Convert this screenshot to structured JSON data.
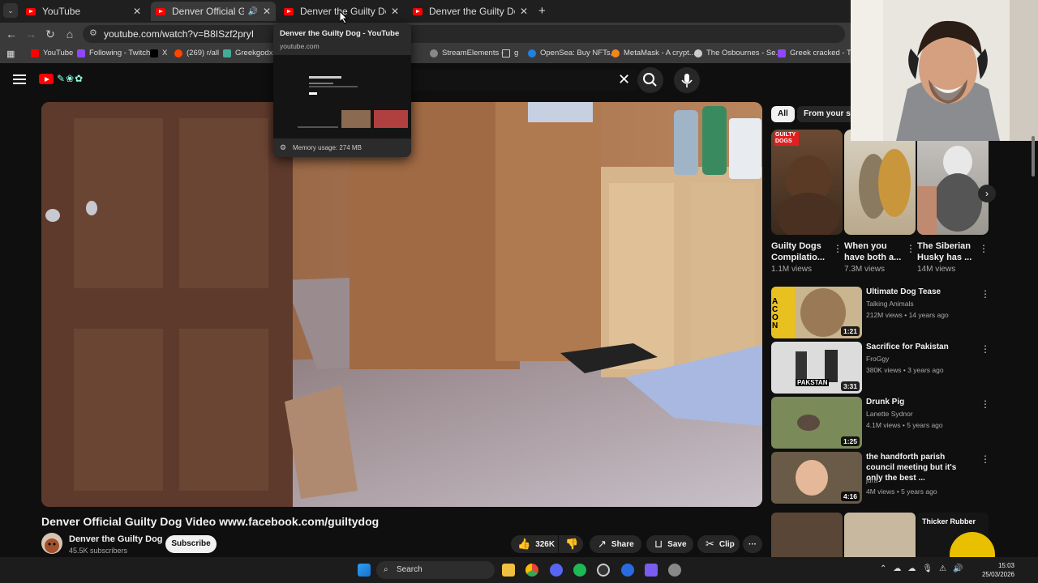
{
  "browser": {
    "tabs": [
      {
        "title": "YouTube",
        "active": false
      },
      {
        "title": "Denver Official Guilty Dog Vide",
        "active": true
      },
      {
        "title": "Denver the Guilty Dog - YouTub",
        "active": false
      },
      {
        "title": "Denver the Guilty Dog - YouTub",
        "active": false
      }
    ],
    "new_tab": "+",
    "url": "youtube.com/watch?v=B8ISzf2pryI",
    "bookmarks": [
      "YouTube",
      "Following - Twitch",
      "X",
      "(269) r/all",
      "Greekgodx -",
      "StreamElements -",
      "g",
      "OpenSea: Buy NFTs,...",
      "MetaMask - A crypt...",
      "The Osbournes - Se...",
      "Greek cracked - Twi..."
    ],
    "tab_preview": {
      "title": "Denver the Guilty Dog - YouTube",
      "url": "youtube.com",
      "memory": "Memory usage: 274 MB"
    }
  },
  "youtube": {
    "video_title": "Denver Official Guilty Dog Video www.facebook.com/guiltydog",
    "channel": {
      "name": "Denver the Guilty Dog",
      "subscribers": "45.5K subscribers"
    },
    "subscribe_label": "Subscribe",
    "actions": {
      "likes": "326K",
      "share": "Share",
      "save": "Save",
      "clip": "Clip",
      "more": "···"
    },
    "chips": [
      "All",
      "From your sea"
    ],
    "shorts": [
      {
        "title": "Guilty Dogs Compilatio...",
        "views": "1.1M views"
      },
      {
        "title": "When you have both a...",
        "views": "7.3M views"
      },
      {
        "title": "The Siberian Husky has ...",
        "views": "14M views"
      }
    ],
    "shorts_badge": "GUILTY DOGS",
    "recommendations": [
      {
        "title": "Ultimate Dog Tease",
        "channel": "Talking Animals",
        "meta": "212M views • 14 years ago",
        "duration": "1:21",
        "thumb_text": "ACON"
      },
      {
        "title": "Sacrifice for Pakistan",
        "channel": "FroGgy",
        "meta": "380K views • 3 years ago",
        "duration": "3:31",
        "thumb_text": "PAKSTAN"
      },
      {
        "title": "Drunk Pig",
        "channel": "Lanette Sydnor",
        "meta": "4.1M views • 5 years ago",
        "duration": "1:25"
      },
      {
        "title": "the handforth parish council meeting but it's only the best ...",
        "channel": "jura",
        "meta": "4M views • 5 years ago",
        "duration": "4:16"
      }
    ],
    "bottom_thumb_text": "Thicker Rubber"
  },
  "taskbar": {
    "search_label": "Search",
    "time": "15:03",
    "date": "25/03/2026"
  },
  "colors": {
    "youtube_red": "#ff0000",
    "background": "#0f0f0f",
    "chip_active": "#f1f1f1"
  }
}
